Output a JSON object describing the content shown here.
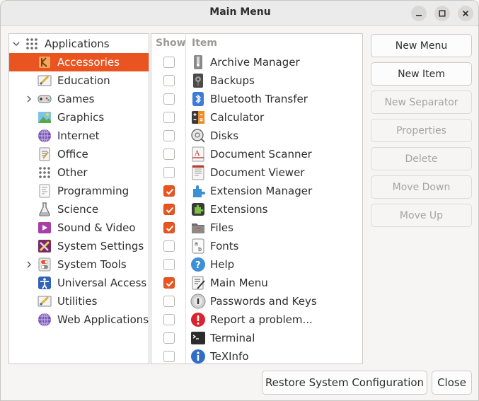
{
  "window": {
    "title": "Main Menu"
  },
  "colors": {
    "accent": "#e95420"
  },
  "tree": {
    "root_label": "Applications",
    "items": [
      {
        "label": "Accessories",
        "icon": "accessories-icon",
        "selected": true,
        "expandable": false
      },
      {
        "label": "Education",
        "icon": "education-icon",
        "selected": false,
        "expandable": false
      },
      {
        "label": "Games",
        "icon": "games-icon",
        "selected": false,
        "expandable": true
      },
      {
        "label": "Graphics",
        "icon": "graphics-icon",
        "selected": false,
        "expandable": false
      },
      {
        "label": "Internet",
        "icon": "internet-icon",
        "selected": false,
        "expandable": false
      },
      {
        "label": "Office",
        "icon": "office-icon",
        "selected": false,
        "expandable": false
      },
      {
        "label": "Other",
        "icon": "other-icon",
        "selected": false,
        "expandable": false
      },
      {
        "label": "Programming",
        "icon": "programming-icon",
        "selected": false,
        "expandable": false
      },
      {
        "label": "Science",
        "icon": "science-icon",
        "selected": false,
        "expandable": false
      },
      {
        "label": "Sound & Video",
        "icon": "sound-video-icon",
        "selected": false,
        "expandable": false
      },
      {
        "label": "System Settings",
        "icon": "system-settings-icon",
        "selected": false,
        "expandable": false
      },
      {
        "label": "System Tools",
        "icon": "system-tools-icon",
        "selected": false,
        "expandable": true
      },
      {
        "label": "Universal Access",
        "icon": "universal-access-icon",
        "selected": false,
        "expandable": false
      },
      {
        "label": "Utilities",
        "icon": "utilities-icon",
        "selected": false,
        "expandable": false
      },
      {
        "label": "Web Applications",
        "icon": "web-applications-icon",
        "selected": false,
        "expandable": false
      }
    ]
  },
  "items_table": {
    "headers": {
      "show": "Show",
      "item": "Item"
    },
    "rows": [
      {
        "label": "Archive Manager",
        "icon": "archive-manager-icon",
        "shown": false
      },
      {
        "label": "Backups",
        "icon": "backups-icon",
        "shown": false
      },
      {
        "label": "Bluetooth Transfer",
        "icon": "bluetooth-icon",
        "shown": false
      },
      {
        "label": "Calculator",
        "icon": "calculator-icon",
        "shown": false
      },
      {
        "label": "Disks",
        "icon": "disks-icon",
        "shown": false
      },
      {
        "label": "Document Scanner",
        "icon": "document-scanner-icon",
        "shown": false
      },
      {
        "label": "Document Viewer",
        "icon": "document-viewer-icon",
        "shown": false
      },
      {
        "label": "Extension Manager",
        "icon": "extension-manager-icon",
        "shown": true
      },
      {
        "label": "Extensions",
        "icon": "extensions-icon",
        "shown": true
      },
      {
        "label": "Files",
        "icon": "files-icon",
        "shown": true
      },
      {
        "label": "Fonts",
        "icon": "fonts-icon",
        "shown": false
      },
      {
        "label": "Help",
        "icon": "help-icon",
        "shown": false
      },
      {
        "label": "Main Menu",
        "icon": "main-menu-icon",
        "shown": true
      },
      {
        "label": "Passwords and Keys",
        "icon": "passwords-keys-icon",
        "shown": false
      },
      {
        "label": "Report a problem...",
        "icon": "report-problem-icon",
        "shown": false
      },
      {
        "label": "Terminal",
        "icon": "terminal-icon",
        "shown": false
      },
      {
        "label": "TeXInfo",
        "icon": "texinfo-icon",
        "shown": false
      }
    ]
  },
  "actions": [
    {
      "label": "New Menu",
      "enabled": true
    },
    {
      "label": "New Item",
      "enabled": true
    },
    {
      "label": "New Separator",
      "enabled": false
    },
    {
      "label": "Properties",
      "enabled": false
    },
    {
      "label": "Delete",
      "enabled": false
    },
    {
      "label": "Move Down",
      "enabled": false
    },
    {
      "label": "Move Up",
      "enabled": false
    }
  ],
  "footer": {
    "restore_label": "Restore System Configuration",
    "close_label": "Close"
  }
}
